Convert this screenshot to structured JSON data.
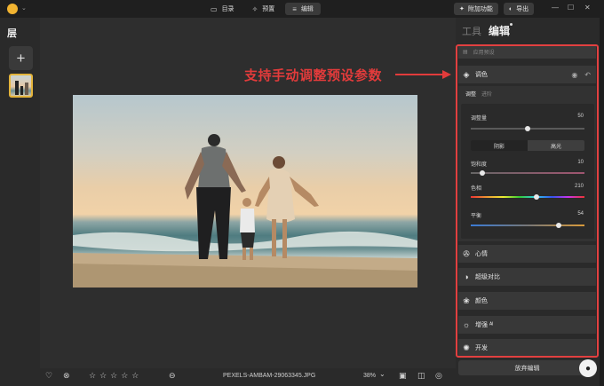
{
  "app": {
    "nav": [
      {
        "label": "目录",
        "icon": "folder-icon"
      },
      {
        "label": "预置",
        "icon": "sparkle-icon"
      },
      {
        "label": "编辑",
        "icon": "sliders-icon"
      }
    ],
    "extras_label": "附加功能",
    "export_label": "导出"
  },
  "left": {
    "title": "层"
  },
  "panel": {
    "tab_tools": "工具",
    "tab_edit": "编辑",
    "preset_label": "应用预设",
    "tone": {
      "title": "调色",
      "subtab_adjust": "调整",
      "subtab_advanced": "进阶",
      "sliders": {
        "adjust_amount": {
          "label": "调整量",
          "value": "50",
          "level": 0.5
        },
        "saturation": {
          "label": "饱和度",
          "value": "10",
          "level": 0.1
        },
        "hue": {
          "label": "色相",
          "value": "210",
          "level": 0.58
        },
        "balance": {
          "label": "平衡",
          "value": "54",
          "level": 0.77
        }
      },
      "seg_shadow": "阴影",
      "seg_highlight": "高光"
    },
    "sections": [
      {
        "label": "心情",
        "icon": "mood-icon"
      },
      {
        "label": "超级对比",
        "icon": "contrast-icon"
      },
      {
        "label": "颜色",
        "icon": "color-icon"
      },
      {
        "label": "增强 ᴬᴵ",
        "icon": "enhance-icon"
      },
      {
        "label": "开发",
        "icon": "develop-icon"
      }
    ],
    "discard_label": "放弃编辑"
  },
  "annotation": "支持手动调整预设参数",
  "bottom": {
    "filename": "PEXELS-AMBAM-29063345.JPG",
    "zoom": "38%"
  }
}
